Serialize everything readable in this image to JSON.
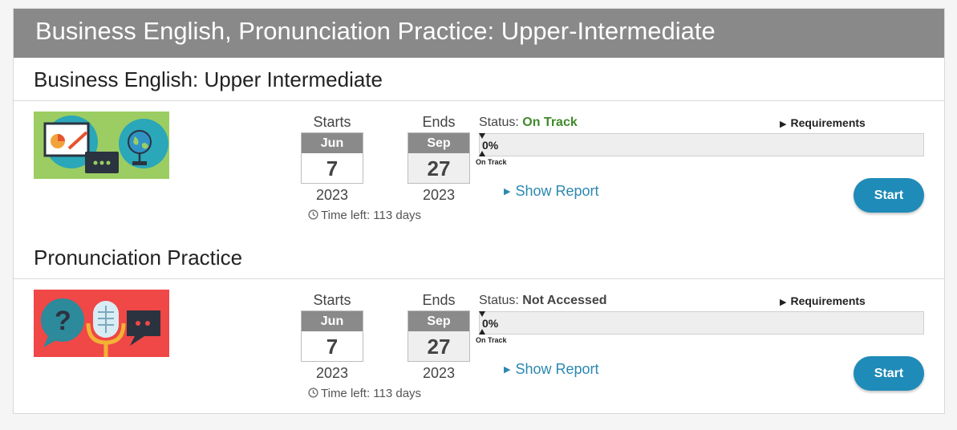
{
  "panel": {
    "title": "Business English, Pronunciation Practice: Upper-Intermediate"
  },
  "courses": [
    {
      "title": "Business English: Upper Intermediate",
      "thumbnail": "business-english-thumbnail",
      "starts": {
        "label": "Starts",
        "month": "Jun",
        "day": "7",
        "year": "2023"
      },
      "ends": {
        "label": "Ends",
        "month": "Sep",
        "day": "27",
        "year": "2023"
      },
      "time_left": "Time left: 113 days",
      "status_label": "Status:",
      "status_value": "On Track",
      "status_color": "#3f8a2a",
      "requirements": "Requirements",
      "progress_percent": "0%",
      "progress_value": 0,
      "progress_marker_label": "On Track",
      "show_report": "Show Report",
      "start_button": "Start"
    },
    {
      "title": "Pronunciation Practice",
      "thumbnail": "pronunciation-thumbnail",
      "starts": {
        "label": "Starts",
        "month": "Jun",
        "day": "7",
        "year": "2023"
      },
      "ends": {
        "label": "Ends",
        "month": "Sep",
        "day": "27",
        "year": "2023"
      },
      "time_left": "Time left: 113 days",
      "status_label": "Status:",
      "status_value": "Not Accessed",
      "status_color": "#444444",
      "requirements": "Requirements",
      "progress_percent": "0%",
      "progress_value": 0,
      "progress_marker_label": "On Track",
      "show_report": "Show Report",
      "start_button": "Start"
    }
  ],
  "colors": {
    "header_bg": "#898989",
    "accent": "#1f8bb8",
    "link": "#2a88b0"
  }
}
